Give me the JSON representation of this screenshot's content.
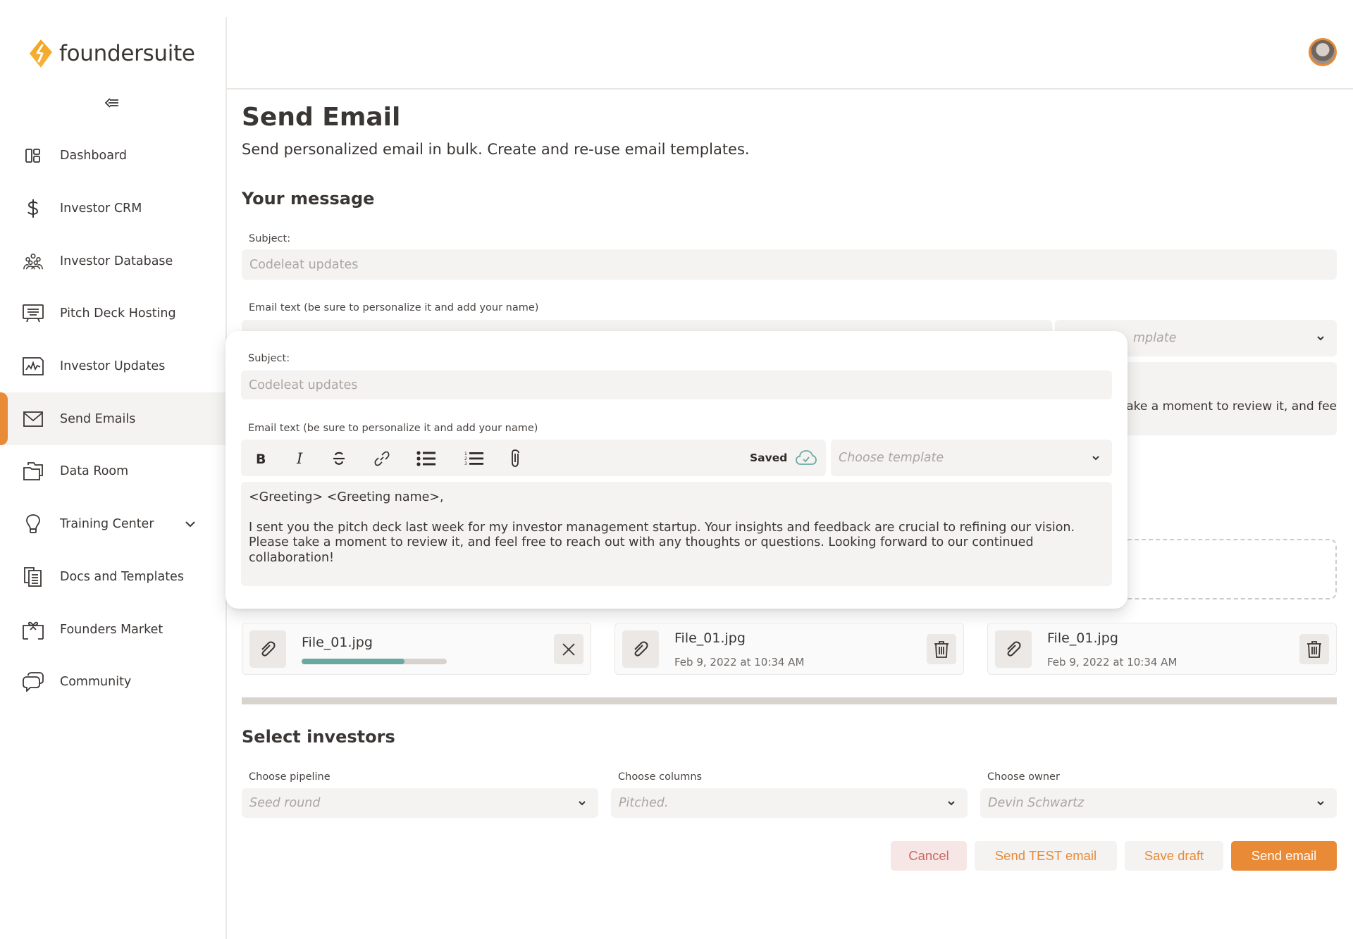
{
  "app": {
    "brand_name": "foundersuite",
    "accent_color": "#e88a36",
    "teal_color": "#6aa9a2"
  },
  "sidebar": {
    "collapse_icon": "collapse-sidebar-icon",
    "items": [
      {
        "label": "Dashboard",
        "icon": "dashboard-icon",
        "active": false
      },
      {
        "label": "Investor CRM",
        "icon": "dollar-icon",
        "active": false
      },
      {
        "label": "Investor Database",
        "icon": "people-group-icon",
        "active": false
      },
      {
        "label": "Pitch Deck Hosting",
        "icon": "presentation-icon",
        "active": false
      },
      {
        "label": "Investor Updates",
        "icon": "chart-report-icon",
        "active": false
      },
      {
        "label": "Send Emails",
        "icon": "envelope-icon",
        "active": true
      },
      {
        "label": "Data Room",
        "icon": "folders-icon",
        "active": false
      },
      {
        "label": "Training Center",
        "icon": "lightbulb-icon",
        "active": false,
        "expandable": true
      },
      {
        "label": "Docs and Templates",
        "icon": "documents-icon",
        "active": false
      },
      {
        "label": "Founders Market",
        "icon": "gift-icon",
        "active": false
      },
      {
        "label": "Community",
        "icon": "chat-bubbles-icon",
        "active": false
      }
    ]
  },
  "header": {
    "avatar": "user-avatar"
  },
  "page": {
    "title": "Send Email",
    "subtitle": "Send personalized email in bulk. Create and re-use email templates."
  },
  "message": {
    "section_title": "Your message",
    "subject_label": "Subject:",
    "subject_value": "Codeleat updates",
    "email_text_label": "Email text (be sure to personalize it and add your name)",
    "underlying_template_partial": "mplate",
    "underlying_body_partial": "ake a moment to review it, and fee"
  },
  "popup": {
    "subject_label": "Subject:",
    "subject_value": "Codeleat updates",
    "email_text_label": "Email text (be sure to personalize it and add your name)",
    "toolbar": {
      "buttons": [
        "bold",
        "italic",
        "strikethrough",
        "link",
        "bullet-list",
        "numbered-list",
        "attachment"
      ],
      "saved_label": "Saved"
    },
    "template_placeholder": "Choose template",
    "body": {
      "greeting": "<Greeting> <Greeting name>,",
      "paragraph": "I sent you the pitch deck last week for my investor management startup. Your insights and feedback are crucial to refining our vision. Please take a moment to review it, and feel free to reach out with any thoughts or questions. Looking forward to our continued collaboration!"
    }
  },
  "files": [
    {
      "name": "File_01.jpg",
      "status": "uploading",
      "progress": 0.71,
      "action": "cancel"
    },
    {
      "name": "File_01.jpg",
      "date": "Feb 9, 2022 at 10:34 AM",
      "status": "uploaded",
      "action": "delete"
    },
    {
      "name": "File_01.jpg",
      "date": "Feb 9, 2022 at 10:34 AM",
      "status": "uploaded",
      "action": "delete"
    }
  ],
  "investors": {
    "section_title": "Select investors",
    "pipeline_label": "Choose pipeline",
    "pipeline_value": "Seed round",
    "columns_label": "Choose columns",
    "columns_value": "Pitched.",
    "owner_label": "Choose owner",
    "owner_value": "Devin Schwartz"
  },
  "actions": {
    "cancel": "Cancel",
    "send_test": "Send TEST email",
    "save_draft": "Save draft",
    "send": "Send email"
  }
}
